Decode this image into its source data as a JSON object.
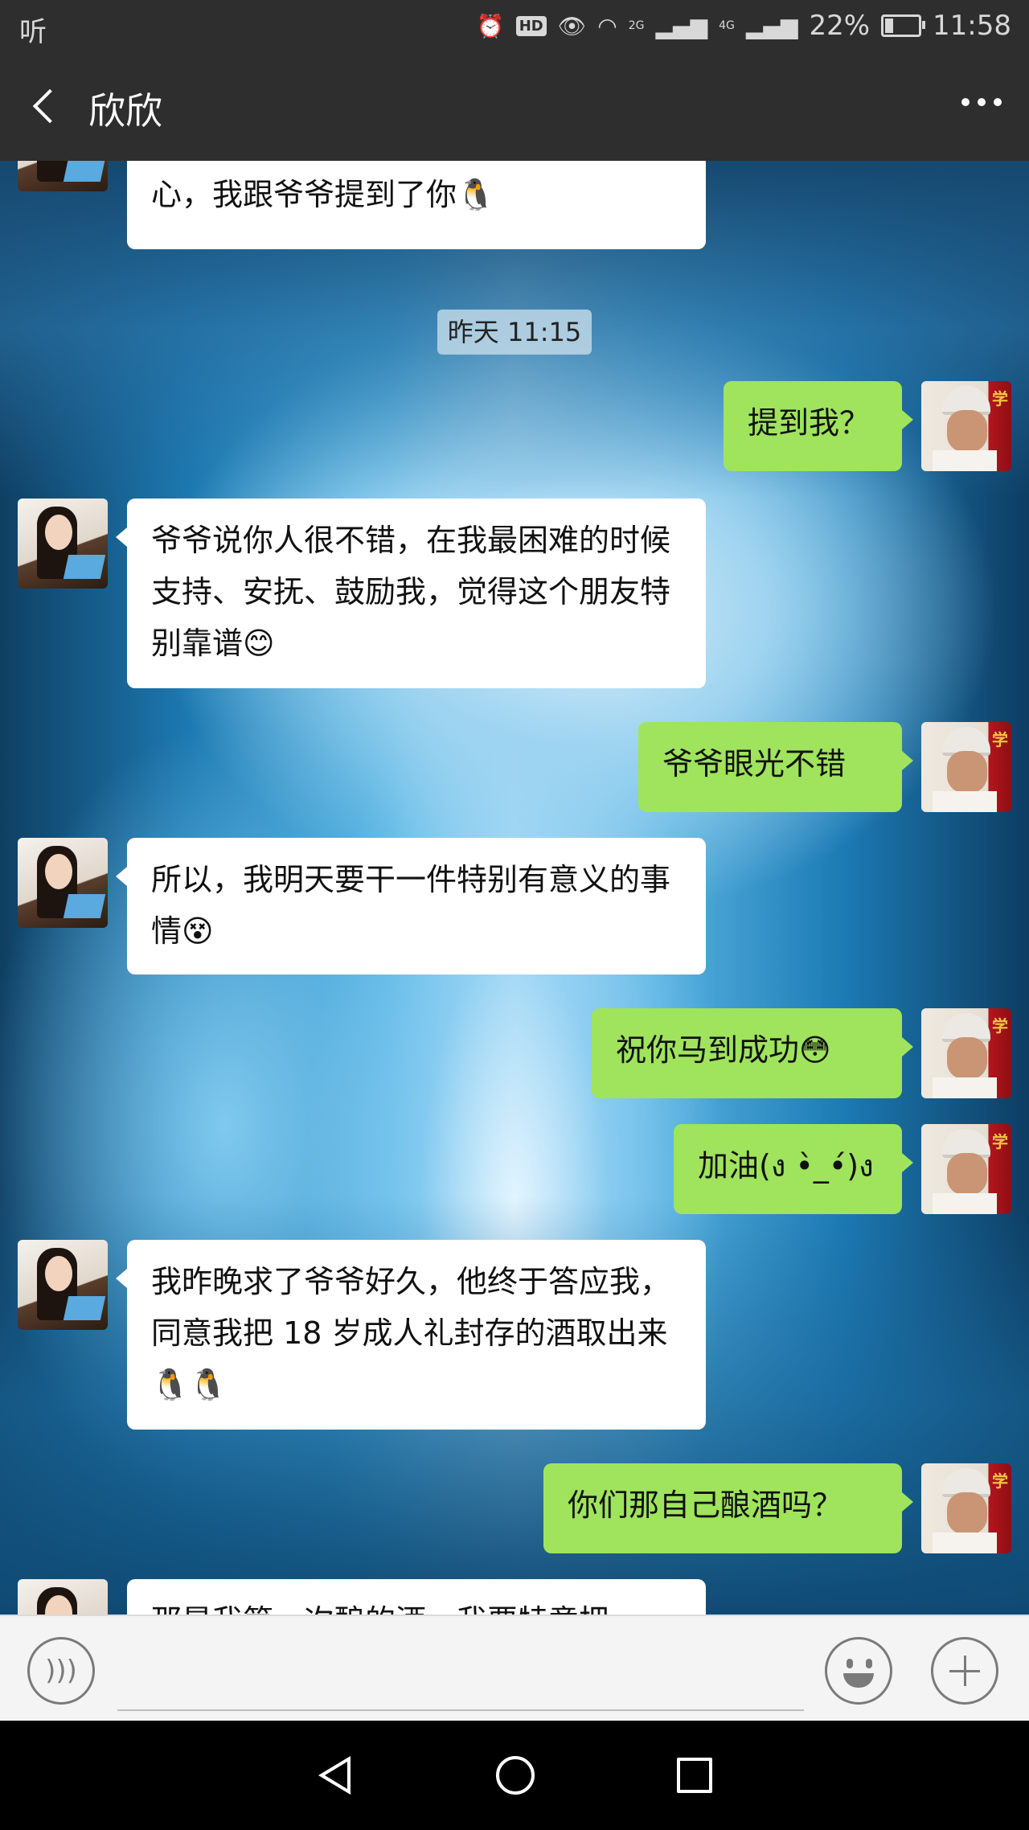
{
  "status_bar": {
    "left_icon": "听",
    "network_1": "2G",
    "network_2": "4G",
    "battery_percent": "22%",
    "battery_level": 0.22,
    "time": "11:58"
  },
  "header": {
    "title": "欣欣"
  },
  "chat": {
    "timestamp": "昨天 11:15",
    "messages": [
      {
        "from": "her",
        "text": "昨天晚上跟爷爷聊得特别晚，特别开心，我跟爷爷提到了你🐧"
      },
      {
        "from": "me",
        "text": "提到我？"
      },
      {
        "from": "her",
        "text": "爷爷说你人很不错，在我最困难的时候支持、安抚、鼓励我，觉得这个朋友特别靠谱😊"
      },
      {
        "from": "me",
        "text": "爷爷眼光不错"
      },
      {
        "from": "her",
        "text": "所以，我明天要干一件特别有意义的事情😵"
      },
      {
        "from": "me",
        "text": "祝你马到成功😳"
      },
      {
        "from": "me",
        "text": "加油(ง •̀_•́)ง"
      },
      {
        "from": "her",
        "text": "我昨晚求了爷爷好久，他终于答应我，同意我把 18 岁成人礼封存的酒取出来🐧🐧"
      },
      {
        "from": "me",
        "text": "你们那自己酿酒吗？"
      },
      {
        "from": "her",
        "text": "那是我第一次酿的酒，我要特意把"
      }
    ]
  },
  "input_bar": {
    "voice_icon": "voice-icon",
    "emoji_icon": "emoji-icon",
    "plus_icon": "plus-icon"
  }
}
